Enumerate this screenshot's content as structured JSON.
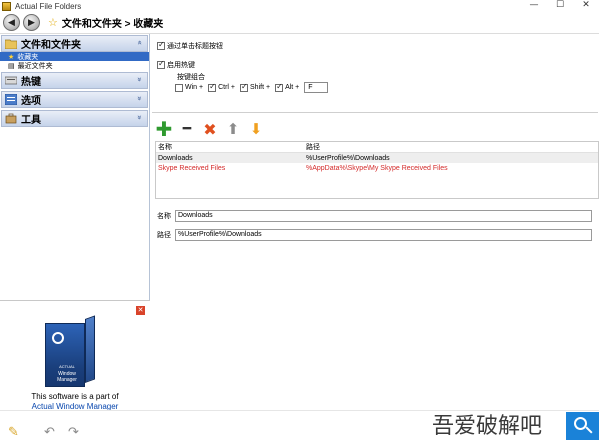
{
  "window": {
    "title": "Actual File Folders",
    "buttons": {
      "minimize": "—",
      "maximize": "☐",
      "close": "✕"
    }
  },
  "address": {
    "back_icon": "◀",
    "forward_icon": "▶",
    "star_icon": "☆",
    "breadcrumb": "文件和文件夹 > 收藏夹"
  },
  "sidebar": {
    "sections": [
      {
        "label": "文件和文件夹",
        "chevron": "»",
        "icon": "folder-icon"
      },
      {
        "label": "热键",
        "chevron": "»",
        "icon": "keyboard-icon"
      },
      {
        "label": "选项",
        "chevron": "»",
        "icon": "options-icon"
      },
      {
        "label": "工具",
        "chevron": "»",
        "icon": "tools-icon"
      }
    ],
    "subitems": [
      {
        "label": "收藏夹",
        "icon": "★"
      },
      {
        "label": "最近文件夹",
        "icon": "▤"
      }
    ]
  },
  "promo": {
    "close": "✕",
    "box_text_small": "ACTUAL",
    "box_text": "Window Manager",
    "line1": "This software is a part of",
    "link": "Actual Window Manager"
  },
  "settings": {
    "title_click": "通过单击标题按钮",
    "enable_hotkey": "启用热键",
    "key_combo": "按键组合",
    "modifiers": [
      {
        "label": "Win +",
        "checked": false
      },
      {
        "label": "Ctrl +",
        "checked": true
      },
      {
        "label": "Shift +",
        "checked": true
      },
      {
        "label": "Alt +",
        "checked": true
      }
    ],
    "key": "F"
  },
  "toolbar": {
    "add": "✚",
    "remove": "━",
    "delete": "✖",
    "up": "⬆",
    "down": "⬇"
  },
  "list": {
    "columns": [
      "名称",
      "路径"
    ],
    "rows": [
      {
        "name": "Downloads",
        "path": "%UserProfile%\\Downloads"
      },
      {
        "name": "Skype Received Files",
        "path": "%AppData%\\Skype\\My Skype Received Files"
      }
    ]
  },
  "editor": {
    "name_label": "名称",
    "name_value": "Downloads",
    "path_label": "路径",
    "path_value": "%UserProfile%\\Downloads"
  },
  "statusbar": {
    "icon1": "✎",
    "icon2": "↶",
    "icon3": "↷"
  },
  "watermark": {
    "text": "吾爱破解吧"
  }
}
